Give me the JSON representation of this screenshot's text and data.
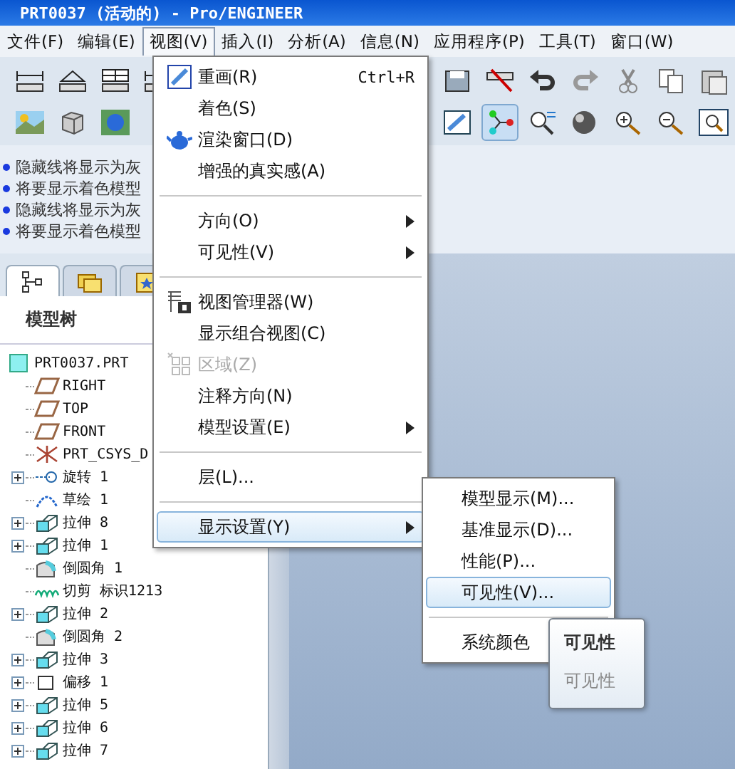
{
  "window": {
    "title": "PRT0037 (活动的) - Pro/ENGINEER"
  },
  "menubar": [
    {
      "label": "文件(F)",
      "selected": false
    },
    {
      "label": "编辑(E)",
      "selected": false
    },
    {
      "label": "视图(V)",
      "selected": true
    },
    {
      "label": "插入(I)",
      "selected": false
    },
    {
      "label": "分析(A)",
      "selected": false
    },
    {
      "label": "信息(N)",
      "selected": false
    },
    {
      "label": "应用程序(P)",
      "selected": false
    },
    {
      "label": "工具(T)",
      "selected": false
    },
    {
      "label": "窗口(W)",
      "selected": false
    }
  ],
  "toolbar_rows": [
    {
      "left": [
        {
          "kind": "dimension",
          "pressed": false
        },
        {
          "kind": "angle",
          "pressed": false
        },
        {
          "kind": "grid-measure",
          "pressed": false
        },
        {
          "kind": "dimension",
          "pressed": false
        }
      ],
      "right": [
        {
          "kind": "save",
          "pressed": false
        },
        {
          "kind": "ruler-off",
          "pressed": false
        },
        {
          "kind": "undo",
          "pressed": false
        },
        {
          "kind": "redo",
          "pressed": false
        },
        {
          "kind": "scissors",
          "pressed": false
        },
        {
          "kind": "copy",
          "pressed": false
        },
        {
          "kind": "paste",
          "pressed": false
        }
      ]
    },
    {
      "left": [
        {
          "kind": "landscape",
          "pressed": false
        },
        {
          "kind": "box",
          "pressed": false
        },
        {
          "kind": "globe",
          "pressed": false
        }
      ],
      "right": [
        {
          "kind": "repaint",
          "pressed": false
        },
        {
          "kind": "spin-center",
          "pressed": true
        },
        {
          "kind": "orient",
          "pressed": false
        },
        {
          "kind": "sphere",
          "pressed": false
        },
        {
          "kind": "zoom-in",
          "pressed": false
        },
        {
          "kind": "zoom-out",
          "pressed": false
        },
        {
          "kind": "refit",
          "pressed": false
        }
      ]
    }
  ],
  "messages": [
    {
      "text": "隐藏线将显示为灰"
    },
    {
      "text": "将要显示着色模型"
    },
    {
      "text": "隐藏线将显示为灰"
    },
    {
      "text": "将要显示着色模型"
    }
  ],
  "panel_tabs": [
    {
      "kind": "tree",
      "selected": true
    },
    {
      "kind": "folders",
      "selected": false
    },
    {
      "kind": "favorites",
      "selected": false
    }
  ],
  "model_tree": {
    "title": "模型树",
    "root": {
      "label": "PRT0037.PRT",
      "kind": "part",
      "children": [
        {
          "label": "RIGHT",
          "kind": "datum-plane"
        },
        {
          "label": "TOP",
          "kind": "datum-plane"
        },
        {
          "label": "FRONT",
          "kind": "datum-plane"
        },
        {
          "label": "PRT_CSYS_D",
          "kind": "csys"
        },
        {
          "label": "旋转 1",
          "kind": "revolve",
          "expanded": false
        },
        {
          "label": "草绘 1",
          "kind": "sketch"
        },
        {
          "label": "拉伸 8",
          "kind": "extrude",
          "expanded": false
        },
        {
          "label": "拉伸 1",
          "kind": "extrude",
          "expanded": false
        },
        {
          "label": "倒圆角 1",
          "kind": "round"
        },
        {
          "label": "切剪 标识1213",
          "kind": "cut"
        },
        {
          "label": "拉伸 2",
          "kind": "extrude",
          "expanded": false
        },
        {
          "label": "倒圆角 2",
          "kind": "round"
        },
        {
          "label": "拉伸 3",
          "kind": "extrude",
          "expanded": false
        },
        {
          "label": "偏移 1",
          "kind": "offset",
          "expanded": false
        },
        {
          "label": "拉伸 5",
          "kind": "extrude",
          "expanded": false
        },
        {
          "label": "拉伸 6",
          "kind": "extrude",
          "expanded": false
        },
        {
          "label": "拉伸 7",
          "kind": "extrude",
          "expanded": false
        }
      ]
    }
  },
  "view_menu": [
    {
      "kind": "item",
      "label": "重画(R)",
      "shortcut": "Ctrl+R",
      "submenu": false,
      "disabled": false,
      "selected": false
    },
    {
      "kind": "item",
      "label": "着色(S)",
      "submenu": false,
      "disabled": false,
      "selected": false
    },
    {
      "kind": "item",
      "label": "渲染窗口(D)",
      "submenu": false,
      "disabled": false,
      "selected": false
    },
    {
      "kind": "item",
      "label": "增强的真实感(A)",
      "submenu": false,
      "disabled": false,
      "selected": false
    },
    {
      "kind": "separator"
    },
    {
      "kind": "item",
      "label": "方向(O)",
      "submenu": true,
      "disabled": false,
      "selected": false
    },
    {
      "kind": "item",
      "label": "可见性(V)",
      "submenu": true,
      "disabled": false,
      "selected": false
    },
    {
      "kind": "separator"
    },
    {
      "kind": "item",
      "label": "视图管理器(W)",
      "submenu": false,
      "disabled": false,
      "selected": false
    },
    {
      "kind": "item",
      "label": "显示组合视图(C)",
      "submenu": false,
      "disabled": false,
      "selected": false
    },
    {
      "kind": "item",
      "label": "区域(Z)",
      "submenu": false,
      "disabled": true,
      "selected": false
    },
    {
      "kind": "item",
      "label": "注释方向(N)",
      "submenu": false,
      "disabled": false,
      "selected": false
    },
    {
      "kind": "item",
      "label": "模型设置(E)",
      "submenu": true,
      "disabled": false,
      "selected": false
    },
    {
      "kind": "separator"
    },
    {
      "kind": "item",
      "label": "层(L)...",
      "submenu": false,
      "disabled": false,
      "selected": false
    },
    {
      "kind": "separator"
    },
    {
      "kind": "item",
      "label": "显示设置(Y)",
      "submenu": true,
      "disabled": false,
      "selected": true
    }
  ],
  "display_submenu": [
    {
      "kind": "item",
      "label": "模型显示(M)...",
      "selected": false
    },
    {
      "kind": "item",
      "label": "基准显示(D)...",
      "selected": false
    },
    {
      "kind": "item",
      "label": "性能(P)...",
      "selected": false
    },
    {
      "kind": "item",
      "label": "可见性(V)...",
      "selected": true
    },
    {
      "kind": "separator"
    },
    {
      "kind": "item",
      "label": "系统颜色",
      "selected": false
    }
  ],
  "tooltip": {
    "title": "可见性",
    "text": "可见性"
  }
}
